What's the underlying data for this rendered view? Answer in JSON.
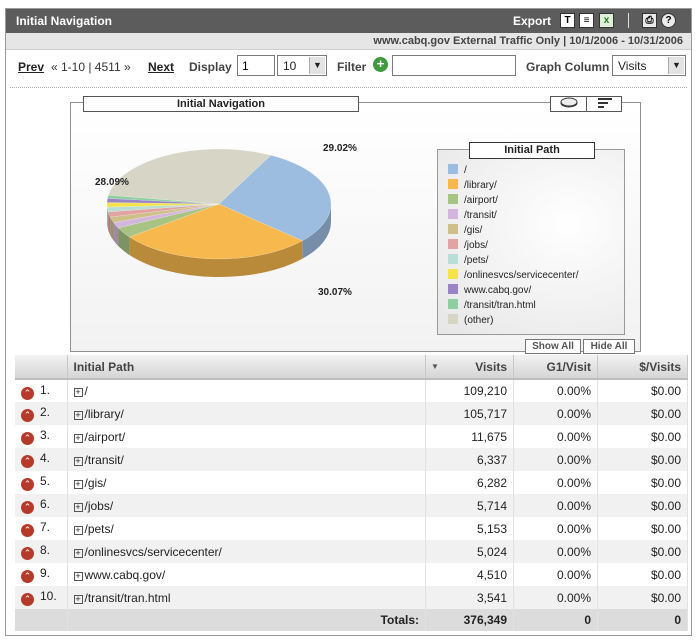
{
  "window": {
    "title": "Initial Navigation"
  },
  "toolbar": {
    "export_label": "Export",
    "icons": [
      "text-export-icon",
      "html-export-icon",
      "excel-export-icon",
      "print-icon",
      "help-icon"
    ]
  },
  "subbar": {
    "info": "www.cabq.gov External Traffic Only  |  10/1/2006 - 10/31/2006"
  },
  "controls": {
    "prev": "Prev",
    "range": "« 1-10 | 4511 »",
    "next": "Next",
    "display_label": "Display",
    "display_start": "1",
    "display_count": "10",
    "filter_label": "Filter",
    "filter_value": "",
    "graph_column_label": "Graph Column",
    "graph_column_value": "Visits"
  },
  "chart": {
    "title": "Initial Navigation",
    "legend_title": "Initial Path",
    "show_all": "Show All",
    "hide_all": "Hide All",
    "pct_labels": [
      "29.02%",
      "28.09%",
      "30.07%"
    ]
  },
  "chart_data": {
    "type": "pie",
    "title": "Initial Navigation",
    "legend_title": "Initial Path",
    "categories": [
      "/",
      "/library/",
      "/airport/",
      "/transit/",
      "/gis/",
      "/jobs/",
      "/pets/",
      "/onlinesvcs/servicecenter/",
      "www.cabq.gov/",
      "/transit/tran.html",
      "(other)"
    ],
    "values": [
      29.02,
      28.09,
      3.1,
      1.68,
      1.67,
      1.52,
      1.37,
      1.33,
      1.2,
      0.94,
      30.07
    ],
    "colors": [
      "#9dbde0",
      "#f7b84d",
      "#a8c485",
      "#d4b6dd",
      "#cfc08a",
      "#e4a3a3",
      "#b9ded6",
      "#f5e34a",
      "#9b84c6",
      "#8dcfa0",
      "#d6d5c6"
    ],
    "legend_position": "right"
  },
  "table": {
    "headers": [
      "Initial Path",
      "Visits",
      "G1/Visit",
      "$/Visits"
    ],
    "rows": [
      {
        "n": "1.",
        "path": "/",
        "visits": "109,210",
        "g1": "0.00%",
        "dv": "$0.00"
      },
      {
        "n": "2.",
        "path": "/library/",
        "visits": "105,717",
        "g1": "0.00%",
        "dv": "$0.00"
      },
      {
        "n": "3.",
        "path": "/airport/",
        "visits": "11,675",
        "g1": "0.00%",
        "dv": "$0.00"
      },
      {
        "n": "4.",
        "path": "/transit/",
        "visits": "6,337",
        "g1": "0.00%",
        "dv": "$0.00"
      },
      {
        "n": "5.",
        "path": "/gis/",
        "visits": "6,282",
        "g1": "0.00%",
        "dv": "$0.00"
      },
      {
        "n": "6.",
        "path": "/jobs/",
        "visits": "5,714",
        "g1": "0.00%",
        "dv": "$0.00"
      },
      {
        "n": "7.",
        "path": "/pets/",
        "visits": "5,153",
        "g1": "0.00%",
        "dv": "$0.00"
      },
      {
        "n": "8.",
        "path": "/onlinesvcs/servicecenter/",
        "visits": "5,024",
        "g1": "0.00%",
        "dv": "$0.00"
      },
      {
        "n": "9.",
        "path": "www.cabq.gov/",
        "visits": "4,510",
        "g1": "0.00%",
        "dv": "$0.00"
      },
      {
        "n": "10.",
        "path": "/transit/tran.html",
        "visits": "3,541",
        "g1": "0.00%",
        "dv": "$0.00"
      }
    ],
    "totals": {
      "label": "Totals:",
      "visits": "376,349",
      "g1": "0",
      "dv": "0"
    }
  }
}
